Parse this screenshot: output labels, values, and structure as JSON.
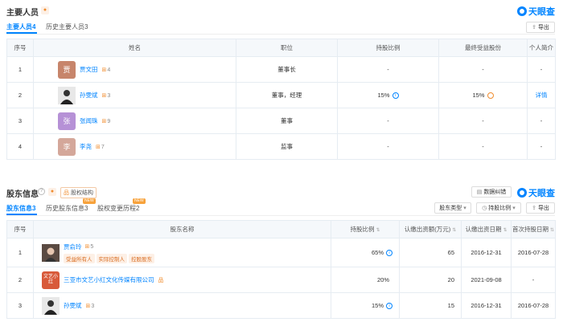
{
  "main_people": {
    "title": "主要人员",
    "tabs": [
      {
        "label": "主要人员",
        "count": "4"
      },
      {
        "label": "历史主要人员",
        "count": "3"
      }
    ],
    "export_label": "导出",
    "logo_text": "天眼查",
    "columns": [
      "序号",
      "姓名",
      "职位",
      "持股比例",
      "最终受益股份",
      "个人简介"
    ],
    "rows": [
      {
        "idx": "1",
        "avatar": "贾",
        "avatar_color": "#c7856b",
        "name": "贾文田",
        "count": "4",
        "position": "董事长",
        "ratio": "-",
        "benefit": "-",
        "intro": "-"
      },
      {
        "idx": "2",
        "avatar": "",
        "avatar_color": "#2b2b2b",
        "name": "孙雯斌",
        "count": "3",
        "position": "董事，经理",
        "ratio": "15%",
        "benefit": "15%",
        "intro": "详情"
      },
      {
        "idx": "3",
        "avatar": "张",
        "avatar_color": "#b691d6",
        "name": "张闻珠",
        "count": "9",
        "position": "董事",
        "ratio": "-",
        "benefit": "-",
        "intro": "-"
      },
      {
        "idx": "4",
        "avatar": "李",
        "avatar_color": "#d4a79a",
        "name": "李尧",
        "count": "7",
        "position": "监事",
        "ratio": "-",
        "benefit": "-",
        "intro": "-"
      }
    ]
  },
  "shareholders": {
    "title": "股东信息",
    "structure_label": "股权结构",
    "tabs": [
      {
        "label": "股东信息",
        "count": "3"
      },
      {
        "label": "历史股东信息",
        "count": "3"
      },
      {
        "label": "股权变更历程",
        "count": "2"
      }
    ],
    "new_badge": "NEW",
    "logo_text": "天眼查",
    "error_btn": "数据纠错",
    "type_btn": "股东类型",
    "ratio_btn": "持股比例",
    "export_label": "导出",
    "columns": [
      "序号",
      "股东名称",
      "持股比例",
      "认缴出资额(万元)",
      "认缴出资日期",
      "首次持股日期"
    ],
    "rows": [
      {
        "idx": "1",
        "name": "贾俞玲",
        "count": "5",
        "tags": [
          "受益所有人",
          "实际控制人",
          "控股股东"
        ],
        "ratio": "65%",
        "amount": "65",
        "date": "2016-12-31",
        "first": "2016-07-28"
      },
      {
        "idx": "2",
        "name": "三亚市文艺小红文化传媒有限公司",
        "logo_text": "文艺小红",
        "count": "",
        "tags": [],
        "ratio": "20%",
        "amount": "20",
        "date": "2021-09-08",
        "first": "-"
      },
      {
        "idx": "3",
        "name": "孙雯斌",
        "count": "3",
        "tags": [],
        "ratio": "15%",
        "amount": "15",
        "date": "2016-12-31",
        "first": "2016-07-28"
      }
    ]
  }
}
